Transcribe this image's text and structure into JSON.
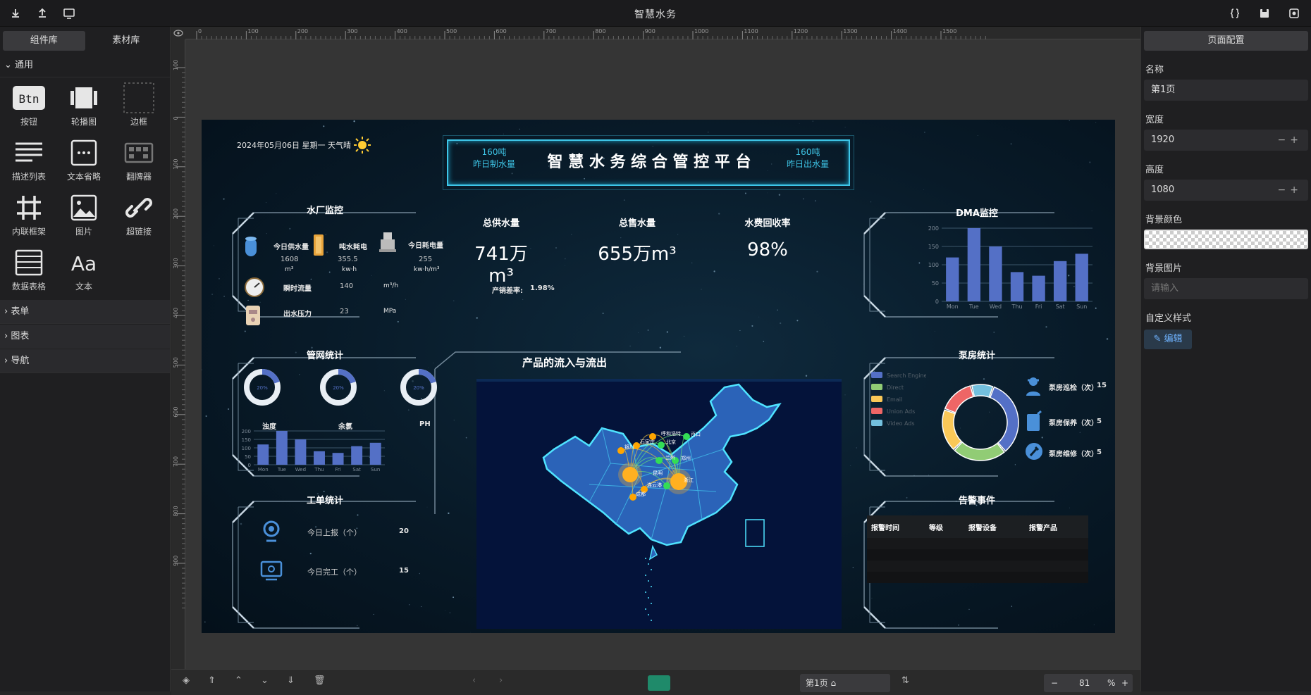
{
  "app": {
    "title": "智慧水务"
  },
  "left_panel": {
    "tabs": [
      "组件库",
      "素材库"
    ],
    "section_general": "通用",
    "components": [
      {
        "label": "按钮",
        "icon": "button-icon"
      },
      {
        "label": "轮播图",
        "icon": "carousel-icon"
      },
      {
        "label": "边框",
        "icon": "border-icon"
      },
      {
        "label": "描述列表",
        "icon": "description-list-icon"
      },
      {
        "label": "文本省略",
        "icon": "text-ellipsis-icon"
      },
      {
        "label": "翻牌器",
        "icon": "flipper-icon"
      },
      {
        "label": "内联框架",
        "icon": "iframe-icon"
      },
      {
        "label": "图片",
        "icon": "image-icon"
      },
      {
        "label": "超链接",
        "icon": "link-icon"
      },
      {
        "label": "数据表格",
        "icon": "data-table-icon"
      },
      {
        "label": "文本",
        "icon": "text-icon"
      }
    ],
    "collapsed_sections": [
      "表单",
      "图表",
      "导航"
    ],
    "btn_icon_text": "Btn",
    "text_icon_text": "Aa"
  },
  "ruler": {
    "h_ticks": [
      "0",
      "100",
      "200",
      "300",
      "400",
      "500",
      "600",
      "700",
      "800",
      "900",
      "1000",
      "1100",
      "1200",
      "1300",
      "1400",
      "1500"
    ],
    "v_ticks": [
      "100",
      "0",
      "100",
      "200",
      "300",
      "400",
      "500",
      "600",
      "700",
      "800",
      "900"
    ]
  },
  "dashboard": {
    "datetime": "2024年05月06日 星期一 天气晴",
    "main_title": "智 慧 水 务 综 合 管 控 平 台",
    "left_badge": {
      "value": "160吨",
      "label": "昨日制水量"
    },
    "right_badge": {
      "value": "160吨",
      "label": "昨日出水量"
    },
    "plant": {
      "title": "水厂监控",
      "items": [
        {
          "label": "今日供水量",
          "value": "1608",
          "unit": "m³"
        },
        {
          "label": "吨水耗电",
          "value": "355.5",
          "unit": "kw·h"
        },
        {
          "label": "今日耗电量",
          "value": "255",
          "unit": "kw·h/m³"
        }
      ],
      "rows": [
        {
          "label": "瞬时流量",
          "value": "140",
          "unit": "m³/h"
        },
        {
          "label": "出水压力",
          "value": "23",
          "unit": "MPa"
        }
      ]
    },
    "kpis": [
      {
        "label": "总供水量",
        "value": "741万m³"
      },
      {
        "label": "总售水量",
        "value": "655万m³"
      },
      {
        "label": "水费回收率",
        "value": "98%"
      }
    ],
    "diff": {
      "label": "产销差率:",
      "value": "1.98%"
    },
    "network": {
      "title": "管网统计",
      "gauges": [
        {
          "label": "浊度",
          "text": "20%",
          "value": 20
        },
        {
          "label": "余氯",
          "text": "20%",
          "value": 20
        },
        {
          "label": "PH",
          "text": "20%",
          "value": 20
        }
      ]
    },
    "workorder": {
      "title": "工单统计",
      "items": [
        {
          "label": "今日上报（个）",
          "value": "20"
        },
        {
          "label": "今日完工（个）",
          "value": "15"
        }
      ]
    },
    "map": {
      "title": "产品的流入与流出",
      "cities": [
        "呼和浩特",
        "百口",
        "北京",
        "石家庄",
        "银川",
        "兰州",
        "郑州",
        "连云港",
        "成都",
        "浙江",
        "昆明"
      ]
    },
    "dma": {
      "title": "DMA监控"
    },
    "pump": {
      "title": "泵房统计",
      "legend": [
        "Search Engine",
        "Direct",
        "Email",
        "Union Ads",
        "Video Ads"
      ],
      "colors": [
        "#5470c6",
        "#91cc75",
        "#fac858",
        "#ee6666",
        "#73c0de"
      ],
      "items": [
        {
          "label": "泵房巡检（次）",
          "value": "15"
        },
        {
          "label": "泵房保养（次）",
          "value": "5"
        },
        {
          "label": "泵房维修（次）",
          "value": "5"
        }
      ]
    },
    "alarm": {
      "title": "告警事件",
      "columns": [
        "报警时间",
        "等级",
        "报警设备",
        "报警产品"
      ]
    }
  },
  "chart_data": [
    {
      "type": "bar",
      "title": "DMA监控",
      "categories": [
        "Mon",
        "Tue",
        "Wed",
        "Thu",
        "Fri",
        "Sat",
        "Sun"
      ],
      "values": [
        120,
        200,
        150,
        80,
        70,
        110,
        130
      ],
      "ylim": [
        0,
        200
      ],
      "yticks": [
        "0",
        "50",
        "100",
        "150",
        "200"
      ]
    },
    {
      "type": "bar",
      "title": "管网统计",
      "categories": [
        "Mon",
        "Tue",
        "Wed",
        "Thu",
        "Fri",
        "Sat",
        "Sun"
      ],
      "values": [
        120,
        200,
        150,
        80,
        70,
        110,
        130
      ],
      "ylim": [
        0,
        200
      ],
      "yticks": [
        "0",
        "50",
        "100",
        "150",
        "200"
      ]
    },
    {
      "type": "pie",
      "title": "泵房统计",
      "categories": [
        "Search Engine",
        "Direct",
        "Email",
        "Union Ads",
        "Video Ads"
      ],
      "values": [
        1048,
        735,
        580,
        484,
        300
      ]
    }
  ],
  "right_panel": {
    "title": "页面配置",
    "name_label": "名称",
    "name_value": "第1页",
    "width_label": "宽度",
    "width_value": "1920",
    "height_label": "高度",
    "height_value": "1080",
    "bg_color_label": "背景颜色",
    "bg_image_label": "背景图片",
    "bg_image_placeholder": "请输入",
    "custom_style_label": "自定义样式",
    "edit_label": "编辑"
  },
  "bottom": {
    "page": "第1页",
    "zoom": "81",
    "zoom_unit": "%"
  }
}
